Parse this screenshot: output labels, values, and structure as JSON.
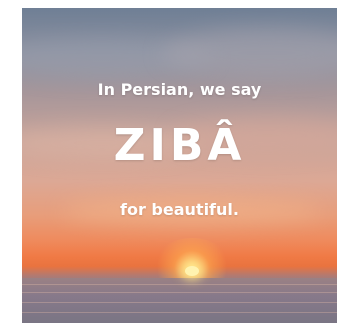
{
  "image": {
    "line_top": "In Persian, we say",
    "headline": "ZIBÂ",
    "line_bottom": "for beautiful.",
    "colors": {
      "sky_top": "#6f7f95",
      "sky_mid": "#dca895",
      "horizon": "#f07a45",
      "sea": "#87798a",
      "text": "#ffffff"
    }
  }
}
